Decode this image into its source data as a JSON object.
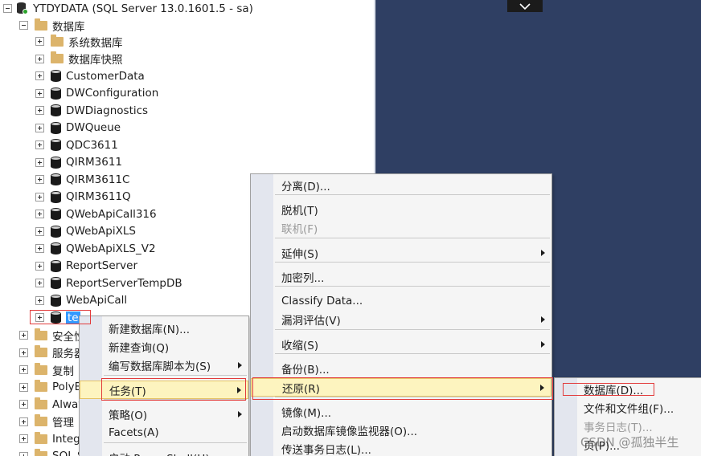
{
  "tree": {
    "server": "YTDYDATA (SQL Server 13.0.1601.5 - sa)",
    "databases_folder": "数据库",
    "db_items": [
      {
        "label": "系统数据库",
        "type": "folder"
      },
      {
        "label": "数据库快照",
        "type": "folder"
      },
      {
        "label": "CustomerData",
        "type": "db"
      },
      {
        "label": "DWConfiguration",
        "type": "db"
      },
      {
        "label": "DWDiagnostics",
        "type": "db"
      },
      {
        "label": "DWQueue",
        "type": "db"
      },
      {
        "label": "QDC3611",
        "type": "db"
      },
      {
        "label": "QIRM3611",
        "type": "db"
      },
      {
        "label": "QIRM3611C",
        "type": "db"
      },
      {
        "label": "QIRM3611Q",
        "type": "db"
      },
      {
        "label": "QWebApiCall316",
        "type": "db"
      },
      {
        "label": "QWebApiXLS",
        "type": "db"
      },
      {
        "label": "QWebApiXLS_V2",
        "type": "db"
      },
      {
        "label": "ReportServer",
        "type": "db"
      },
      {
        "label": "ReportServerTempDB",
        "type": "db"
      },
      {
        "label": "WebApiCall",
        "type": "db"
      },
      {
        "label": "te",
        "type": "db",
        "selected": true
      }
    ],
    "top_items": [
      {
        "label": "安全性"
      },
      {
        "label": "服务器"
      },
      {
        "label": "复制"
      },
      {
        "label": "PolyB"
      },
      {
        "label": "Alway"
      },
      {
        "label": "管理"
      },
      {
        "label": "Integ"
      },
      {
        "label": "SQL S"
      }
    ]
  },
  "menu1": {
    "items": [
      {
        "label": "新建数据库(N)..."
      },
      {
        "label": "新建查询(Q)"
      },
      {
        "label": "编写数据库脚本为(S)",
        "submenu": true
      },
      {
        "label": "任务(T)",
        "submenu": true,
        "highlighted": true
      },
      {
        "label": "策略(O)",
        "submenu": true
      },
      {
        "label": "Facets(A)"
      },
      {
        "label": "启动 PowerShell(H)"
      }
    ]
  },
  "menu2": {
    "items": [
      {
        "label": "分离(D)..."
      },
      {
        "label": "脱机(T)"
      },
      {
        "label": "联机(F)",
        "disabled": true
      },
      {
        "label": "延伸(S)",
        "submenu": true
      },
      {
        "label": "加密列..."
      },
      {
        "label": "Classify Data..."
      },
      {
        "label": "漏洞评估(V)",
        "submenu": true
      },
      {
        "label": "收缩(S)",
        "submenu": true
      },
      {
        "label": "备份(B)..."
      },
      {
        "label": "还原(R)",
        "submenu": true,
        "highlighted": true
      },
      {
        "label": "镜像(M)..."
      },
      {
        "label": "启动数据库镜像监视器(O)..."
      },
      {
        "label": "传送事务日志(L)..."
      }
    ]
  },
  "menu3": {
    "items": [
      {
        "label": "数据库(D)..."
      },
      {
        "label": "文件和文件组(F)..."
      },
      {
        "label": "事务日志(T)...",
        "disabled": true
      },
      {
        "label": "页(P)..."
      }
    ]
  },
  "watermark": "CSDN @孤独半生",
  "colors": {
    "dark_pane": "#2f3f63",
    "selection": "#3399ff",
    "menu_highlight": "#fdf4bf",
    "annotation_red": "#e23b3b"
  }
}
